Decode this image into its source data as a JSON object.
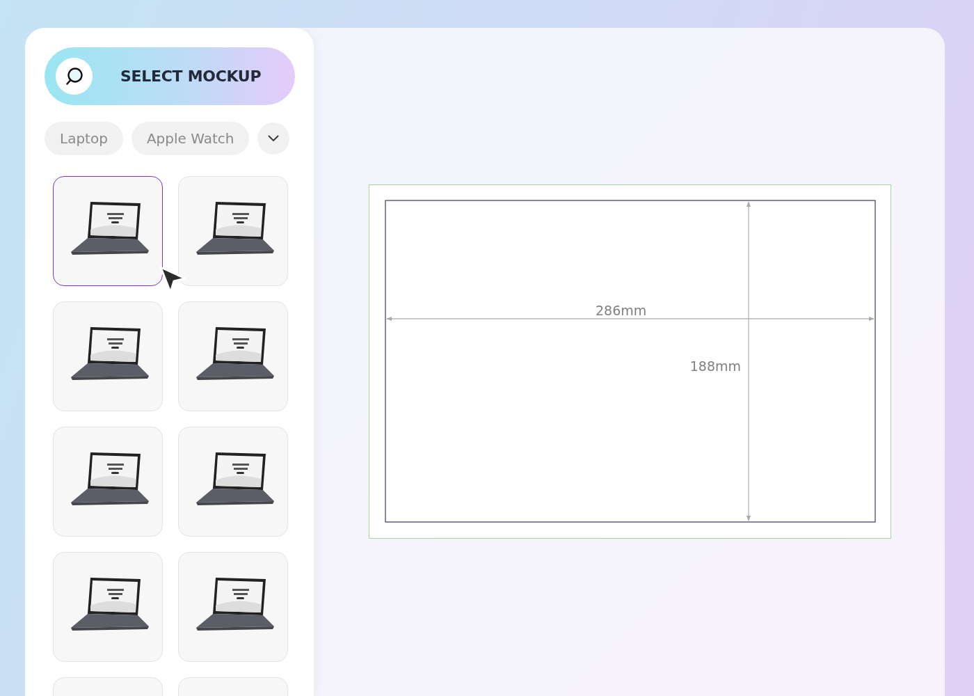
{
  "header": {
    "title": "SELECT MOCKUP"
  },
  "filters": [
    {
      "label": "Laptop",
      "selected": false
    },
    {
      "label": "Apple Watch",
      "selected": false
    }
  ],
  "thumbnails": [
    {
      "selected": true
    },
    {
      "selected": false
    },
    {
      "selected": false
    },
    {
      "selected": false
    },
    {
      "selected": false
    },
    {
      "selected": false
    },
    {
      "selected": false
    },
    {
      "selected": false
    },
    {
      "selected": false
    },
    {
      "selected": false
    }
  ],
  "canvas": {
    "width_label": "286mm",
    "height_label": "188mm"
  }
}
